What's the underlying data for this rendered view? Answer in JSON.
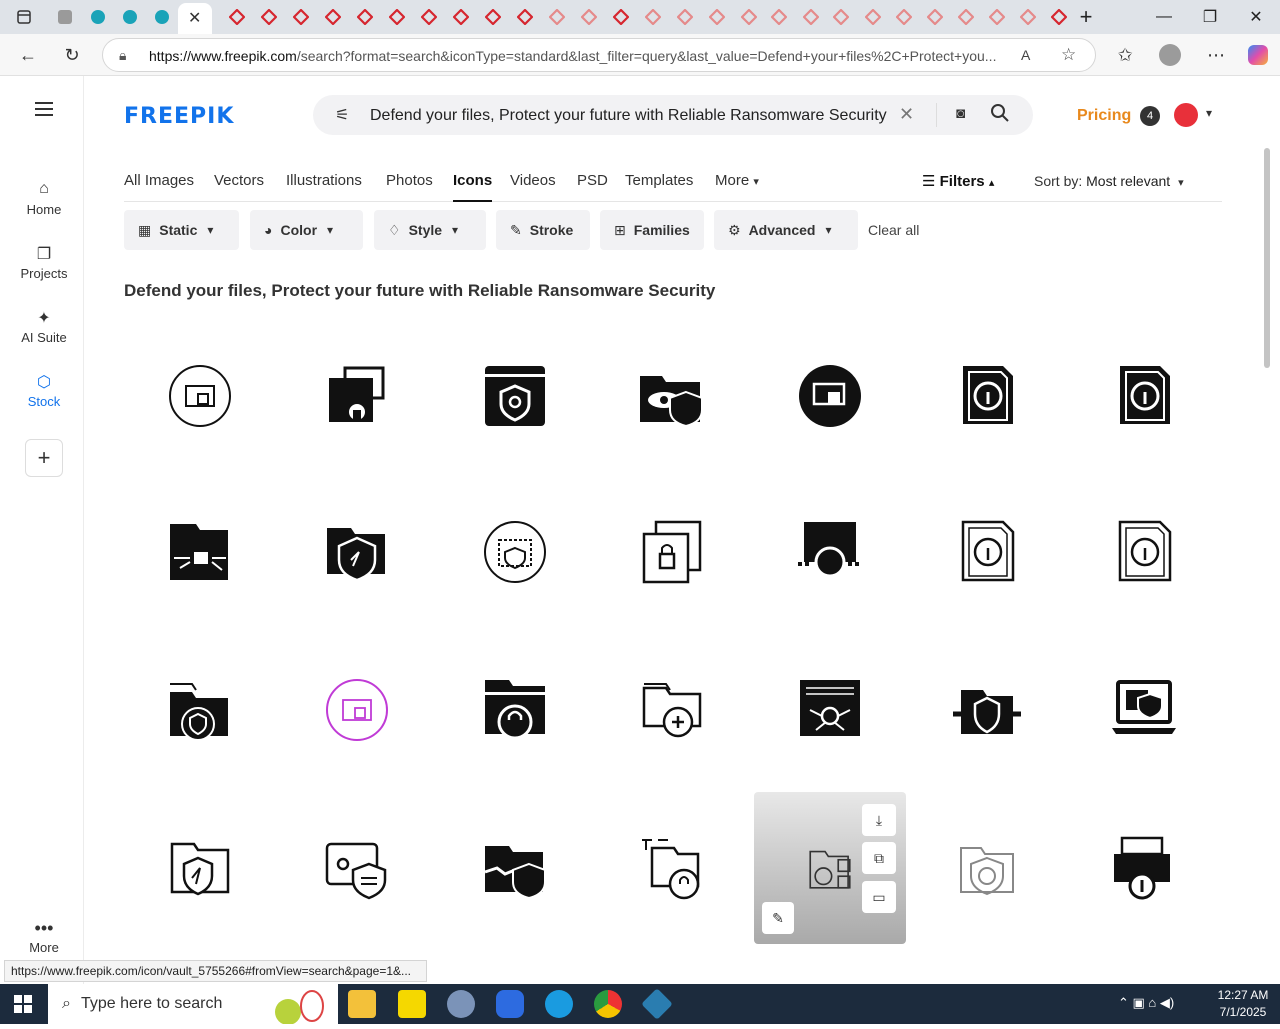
{
  "browser": {
    "url_host": "https://www.freepik.com",
    "url_rest": "/search?format=search&iconType=standard&last_filter=query&last_value=Defend+your+files%2C+Protect+you...",
    "status_url": "https://www.freepik.com/icon/vault_5755266#fromView=search&page=1&..."
  },
  "sidebar": {
    "items": [
      {
        "label": "Home",
        "icon": "home-icon"
      },
      {
        "label": "Projects",
        "icon": "projects-icon"
      },
      {
        "label": "AI Suite",
        "icon": "sparkle-icon"
      },
      {
        "label": "Stock",
        "icon": "stock-icon"
      }
    ],
    "more_label": "More"
  },
  "header": {
    "logo": "FREEPIK",
    "search_value": "Defend your files, Protect your future with Reliable Ransomware Security",
    "pricing": "Pricing",
    "notification_count": "4"
  },
  "tabs": [
    "All Images",
    "Vectors",
    "Illustrations",
    "Photos",
    "Icons",
    "Videos",
    "PSD",
    "Templates",
    "More"
  ],
  "active_tab": "Icons",
  "filters_label": "Filters",
  "sort": {
    "label": "Sort by:",
    "value": "Most relevant"
  },
  "filter_buttons": [
    "Static",
    "Color",
    "Style",
    "Stroke",
    "Families",
    "Advanced"
  ],
  "clear_all": "Clear all",
  "heading": "Defend your files, Protect your future with Reliable Ransomware Security",
  "taskbar": {
    "search_placeholder": "Type here to search",
    "time": "12:27 AM",
    "date": "7/1/2025"
  },
  "colors": {
    "brand": "#1273eb",
    "pricing": "#e8891d",
    "taskbar": "#1c2b3d"
  }
}
